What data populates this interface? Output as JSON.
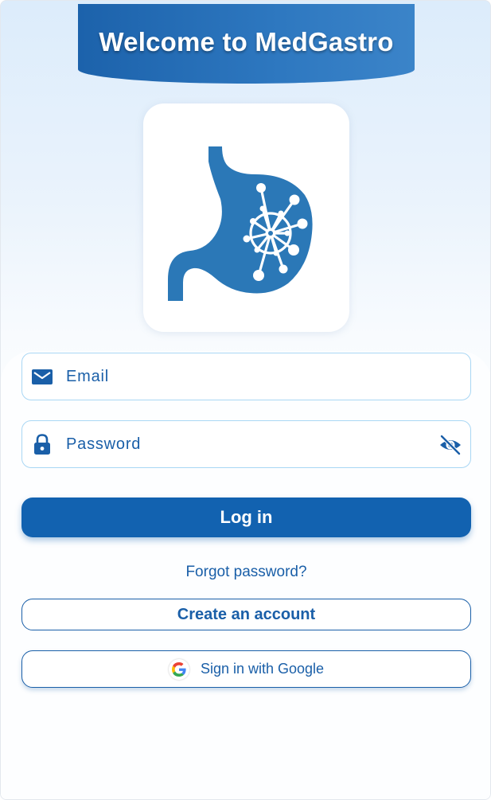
{
  "header": {
    "title": "Welcome to MedGastro"
  },
  "logo": {
    "icon": "stomach-circuit-icon",
    "color": "#2b78b7"
  },
  "form": {
    "email": {
      "placeholder": "Email",
      "icon": "mail-icon"
    },
    "password": {
      "placeholder": "Password",
      "icon": "lock-icon",
      "toggle_icon": "eye-off-icon"
    },
    "login_label": "Log in",
    "forgot_label": "Forgot password?",
    "create_label": "Create an account",
    "google_label": "Sign in with Google",
    "google_icon": "google-g-icon"
  },
  "colors": {
    "primary": "#1262b0",
    "field_border": "#a9d7f4",
    "text_accent": "#1a5fa8"
  }
}
